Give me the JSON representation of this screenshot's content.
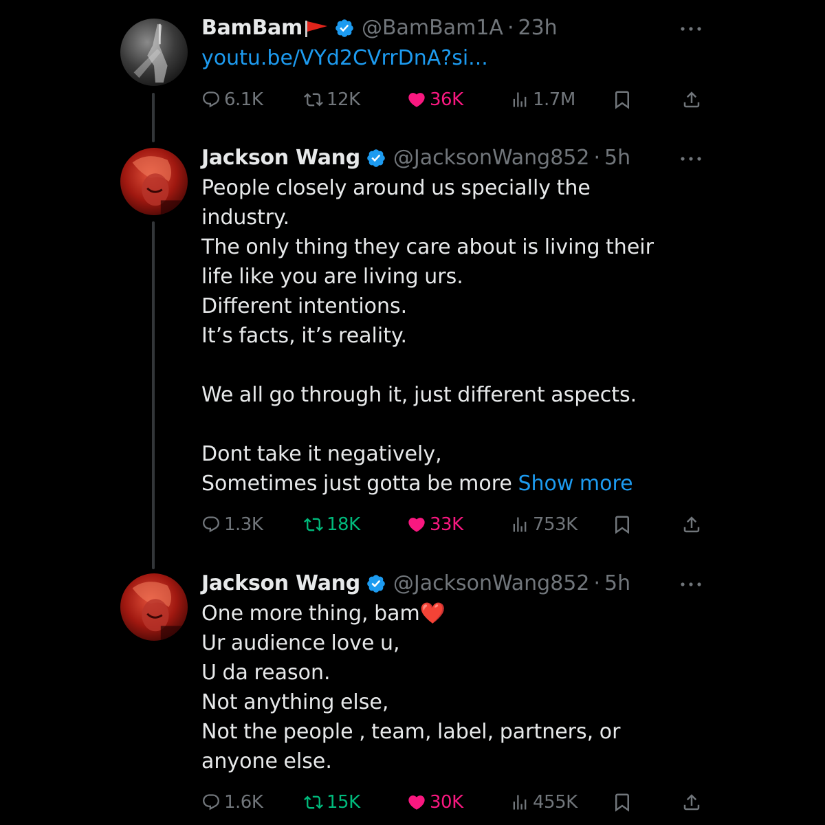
{
  "colors": {
    "background": "#000000",
    "text": "#e7e9ea",
    "muted": "#71767b",
    "accent": "#1d9bf0",
    "retweet_green": "#00ba7c",
    "like_pink": "#f91880",
    "thread_line": "#333639"
  },
  "tweets": [
    {
      "name": "BamBam",
      "badge_icon": "red-flag-icon",
      "verified_icon": "verified-badge-icon",
      "handle": "@BamBam1A",
      "separator": "·",
      "time": "23h",
      "link_text": "youtu.be/VYd2CVrrDnA?si...",
      "replies": "6.1K",
      "retweets": "12K",
      "retweeted": false,
      "likes": "36K",
      "liked": true,
      "views": "1.7M"
    },
    {
      "name": "Jackson Wang",
      "verified_icon": "verified-badge-icon",
      "handle": "@JacksonWang852",
      "separator": "·",
      "time": "5h",
      "text": "People closely around us specially the\nindustry.\nThe only thing they care about is living their\nlife like you are living urs.\nDifferent intentions.\nIt’s facts, it’s reality.\n\nWe all go through it, just different aspects.\n\nDont take it negatively,\nSometimes just gotta be more ",
      "show_more": "Show more",
      "replies": "1.3K",
      "retweets": "18K",
      "retweeted": true,
      "likes": "33K",
      "liked": true,
      "views": "753K"
    },
    {
      "name": "Jackson Wang",
      "verified_icon": "verified-badge-icon",
      "handle": "@JacksonWang852",
      "separator": "·",
      "time": "5h",
      "text": "One more thing, bam❤️\nUr audience love u,\nU da reason.\nNot anything else,\nNot the people , team, label, partners, or\nanyone else.",
      "replies": "1.6K",
      "retweets": "15K",
      "retweeted": true,
      "likes": "30K",
      "liked": true,
      "views": "455K"
    }
  ]
}
